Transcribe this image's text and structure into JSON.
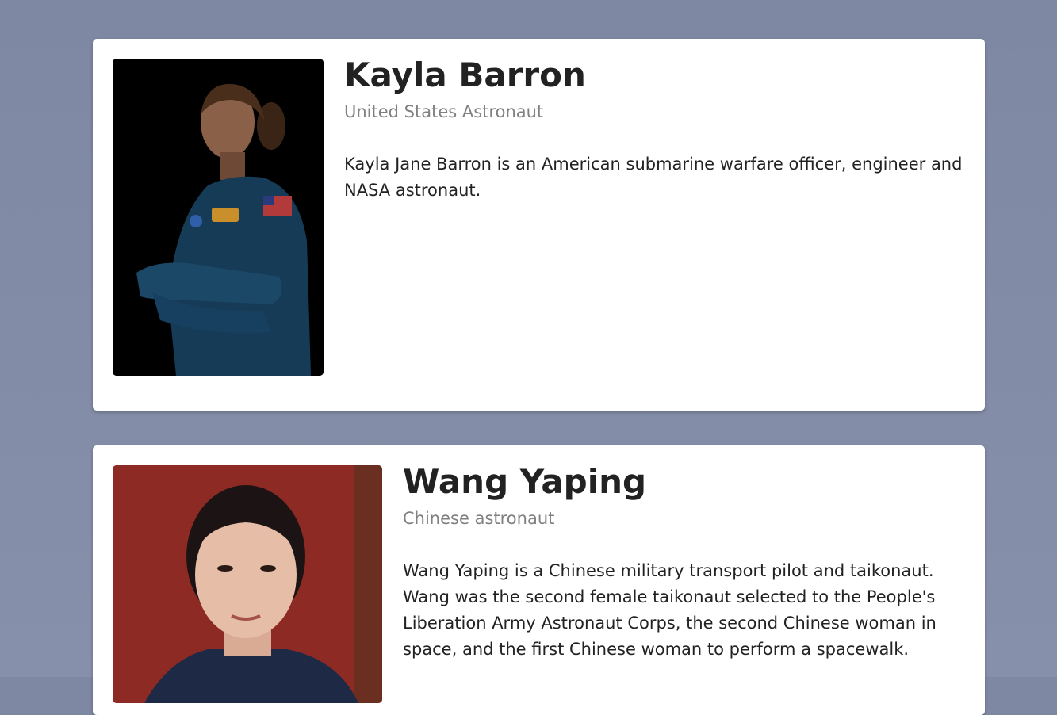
{
  "colors": {
    "background": "#8089a3",
    "card": "#ffffff",
    "name_text": "#222222",
    "role_text": "#808080"
  },
  "astronauts": [
    {
      "name": "Kayla Barron",
      "role": "United States Astronaut",
      "bio": "Kayla Jane Barron is an American submarine warfare officer, engineer and NASA astronaut.",
      "photo_icon": "astronaut-portrait-image"
    },
    {
      "name": "Wang Yaping",
      "role": "Chinese astronaut",
      "bio": "Wang Yaping is a Chinese military transport pilot and taikonaut. Wang was the second female taikonaut selected to the People's Liberation Army Astronaut Corps, the second Chinese woman in space, and the first Chinese woman to perform a spacewalk.",
      "photo_icon": "astronaut-portrait-image"
    }
  ]
}
